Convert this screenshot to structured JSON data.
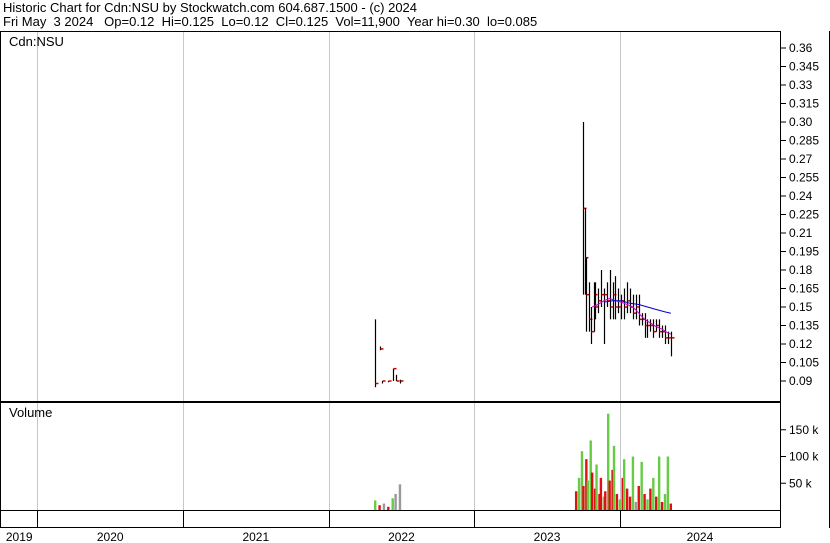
{
  "header": {
    "line1": "Historic Chart for Cdn:NSU by Stockwatch.com 604.687.1500 - (c) 2024",
    "line2": "Fri May  3 2024   Op=0.12  Hi=0.125  Lo=0.12  Cl=0.125  Vol=11,900  Year hi=0.30  lo=0.085"
  },
  "colors": {
    "price_bar": "#000000",
    "close_marker": "#cc0000",
    "moving_average_short": "#cc00cc",
    "moving_average_long": "#0000cc",
    "volume_up": "#66cc44",
    "volume_down": "#dd1111",
    "volume_flat": "#999999",
    "grid": "#c8c8c8"
  },
  "chart_data": {
    "type": "ohlc",
    "symbol_label": "Cdn:NSU",
    "volume_label": "Volume",
    "price_axis": {
      "ticks": [
        "0.36",
        "0.345",
        "0.33",
        "0.315",
        "0.30",
        "0.285",
        "0.27",
        "0.255",
        "0.24",
        "0.225",
        "0.21",
        "0.195",
        "0.18",
        "0.165",
        "0.15",
        "0.135",
        "0.12",
        "0.105",
        "0.09"
      ],
      "ylim": [
        0.075,
        0.37
      ]
    },
    "volume_axis": {
      "ticks": [
        {
          "label": "150 k",
          "value": 150000
        },
        {
          "label": "100 k",
          "value": 100000
        },
        {
          "label": "50 k",
          "value": 50000
        }
      ],
      "ylim": [
        0,
        200000
      ]
    },
    "x_axis": {
      "range": [
        2019.0,
        2024.35
      ],
      "year_labels": [
        {
          "label": "2019",
          "start": 2019.0,
          "end": 2019.25
        },
        {
          "label": "2020",
          "start": 2019.25,
          "end": 2020.25
        },
        {
          "label": "2021",
          "start": 2020.25,
          "end": 2021.25
        },
        {
          "label": "2022",
          "start": 2021.25,
          "end": 2022.25
        },
        {
          "label": "2023",
          "start": 2022.25,
          "end": 2023.25
        },
        {
          "label": "2024",
          "start": 2023.25,
          "end": 2024.35
        }
      ]
    },
    "price_bars": [
      {
        "x": 2021.57,
        "high": 0.14,
        "low": 0.085,
        "close": 0.088
      },
      {
        "x": 2021.6,
        "high": 0.118,
        "low": 0.115,
        "close": 0.116
      },
      {
        "x": 2021.62,
        "high": 0.09,
        "low": 0.088,
        "close": 0.09
      },
      {
        "x": 2021.66,
        "high": 0.09,
        "low": 0.089,
        "close": 0.09
      },
      {
        "x": 2021.69,
        "high": 0.1,
        "low": 0.09,
        "close": 0.1
      },
      {
        "x": 2021.71,
        "high": 0.095,
        "low": 0.09,
        "close": 0.09
      },
      {
        "x": 2021.74,
        "high": 0.091,
        "low": 0.088,
        "close": 0.09
      },
      {
        "x": 2023.0,
        "high": 0.3,
        "low": 0.16,
        "close": 0.23
      },
      {
        "x": 2023.01,
        "high": 0.23,
        "low": 0.16,
        "close": 0.19
      },
      {
        "x": 2023.02,
        "high": 0.19,
        "low": 0.13,
        "close": 0.16
      },
      {
        "x": 2023.04,
        "high": 0.17,
        "low": 0.13,
        "close": 0.14
      },
      {
        "x": 2023.05,
        "high": 0.15,
        "low": 0.12,
        "close": 0.13
      },
      {
        "x": 2023.07,
        "high": 0.17,
        "low": 0.13,
        "close": 0.16
      },
      {
        "x": 2023.08,
        "high": 0.17,
        "low": 0.14,
        "close": 0.15
      },
      {
        "x": 2023.1,
        "high": 0.165,
        "low": 0.145,
        "close": 0.155
      },
      {
        "x": 2023.12,
        "high": 0.18,
        "low": 0.15,
        "close": 0.16
      },
      {
        "x": 2023.14,
        "high": 0.165,
        "low": 0.12,
        "close": 0.16
      },
      {
        "x": 2023.16,
        "high": 0.17,
        "low": 0.15,
        "close": 0.155
      },
      {
        "x": 2023.18,
        "high": 0.18,
        "low": 0.14,
        "close": 0.15
      },
      {
        "x": 2023.2,
        "high": 0.17,
        "low": 0.14,
        "close": 0.16
      },
      {
        "x": 2023.22,
        "high": 0.175,
        "low": 0.14,
        "close": 0.15
      },
      {
        "x": 2023.24,
        "high": 0.165,
        "low": 0.145,
        "close": 0.15
      },
      {
        "x": 2023.26,
        "high": 0.16,
        "low": 0.14,
        "close": 0.155
      },
      {
        "x": 2023.28,
        "high": 0.165,
        "low": 0.14,
        "close": 0.15
      },
      {
        "x": 2023.3,
        "high": 0.17,
        "low": 0.145,
        "close": 0.155
      },
      {
        "x": 2023.32,
        "high": 0.165,
        "low": 0.145,
        "close": 0.15
      },
      {
        "x": 2023.34,
        "high": 0.16,
        "low": 0.14,
        "close": 0.145
      },
      {
        "x": 2023.36,
        "high": 0.16,
        "low": 0.14,
        "close": 0.15
      },
      {
        "x": 2023.38,
        "high": 0.16,
        "low": 0.135,
        "close": 0.14
      },
      {
        "x": 2023.4,
        "high": 0.145,
        "low": 0.135,
        "close": 0.14
      },
      {
        "x": 2023.42,
        "high": 0.145,
        "low": 0.125,
        "close": 0.135
      },
      {
        "x": 2023.44,
        "high": 0.14,
        "low": 0.125,
        "close": 0.135
      },
      {
        "x": 2023.46,
        "high": 0.14,
        "low": 0.13,
        "close": 0.135
      },
      {
        "x": 2023.48,
        "high": 0.14,
        "low": 0.125,
        "close": 0.13
      },
      {
        "x": 2023.5,
        "high": 0.14,
        "low": 0.13,
        "close": 0.135
      },
      {
        "x": 2023.52,
        "high": 0.14,
        "low": 0.125,
        "close": 0.13
      },
      {
        "x": 2023.54,
        "high": 0.135,
        "low": 0.125,
        "close": 0.13
      },
      {
        "x": 2023.56,
        "high": 0.135,
        "low": 0.12,
        "close": 0.125
      },
      {
        "x": 2023.58,
        "high": 0.13,
        "low": 0.12,
        "close": 0.125
      },
      {
        "x": 2023.6,
        "high": 0.13,
        "low": 0.11,
        "close": 0.125
      }
    ],
    "moving_averages": [
      {
        "name": "short",
        "points": [
          [
            2023.06,
            0.15
          ],
          [
            2023.1,
            0.152
          ],
          [
            2023.14,
            0.155
          ],
          [
            2023.18,
            0.157
          ],
          [
            2023.22,
            0.155
          ],
          [
            2023.26,
            0.154
          ],
          [
            2023.3,
            0.152
          ],
          [
            2023.34,
            0.15
          ],
          [
            2023.38,
            0.145
          ],
          [
            2023.42,
            0.14
          ],
          [
            2023.46,
            0.137
          ],
          [
            2023.5,
            0.134
          ],
          [
            2023.54,
            0.132
          ],
          [
            2023.58,
            0.129
          ],
          [
            2023.6,
            0.128
          ]
        ]
      },
      {
        "name": "long",
        "points": [
          [
            2023.14,
            0.154
          ],
          [
            2023.2,
            0.155
          ],
          [
            2023.26,
            0.155
          ],
          [
            2023.32,
            0.153
          ],
          [
            2023.38,
            0.152
          ],
          [
            2023.44,
            0.15
          ],
          [
            2023.5,
            0.148
          ],
          [
            2023.56,
            0.146
          ],
          [
            2023.6,
            0.145
          ]
        ]
      }
    ],
    "volume_bars": [
      {
        "x": 2021.57,
        "v": 18000,
        "dir": "up"
      },
      {
        "x": 2021.6,
        "v": 9000,
        "dir": "down"
      },
      {
        "x": 2021.63,
        "v": 12000,
        "dir": "flat"
      },
      {
        "x": 2021.66,
        "v": 6000,
        "dir": "down"
      },
      {
        "x": 2021.69,
        "v": 22000,
        "dir": "up"
      },
      {
        "x": 2021.71,
        "v": 30000,
        "dir": "flat"
      },
      {
        "x": 2021.74,
        "v": 48000,
        "dir": "flat"
      },
      {
        "x": 2022.95,
        "v": 35000,
        "dir": "down"
      },
      {
        "x": 2022.97,
        "v": 60000,
        "dir": "up"
      },
      {
        "x": 2022.99,
        "v": 110000,
        "dir": "up"
      },
      {
        "x": 2023.0,
        "v": 45000,
        "dir": "down"
      },
      {
        "x": 2023.02,
        "v": 95000,
        "dir": "down"
      },
      {
        "x": 2023.03,
        "v": 55000,
        "dir": "up"
      },
      {
        "x": 2023.05,
        "v": 130000,
        "dir": "up"
      },
      {
        "x": 2023.06,
        "v": 70000,
        "dir": "down"
      },
      {
        "x": 2023.08,
        "v": 40000,
        "dir": "down"
      },
      {
        "x": 2023.09,
        "v": 85000,
        "dir": "up"
      },
      {
        "x": 2023.11,
        "v": 30000,
        "dir": "down"
      },
      {
        "x": 2023.12,
        "v": 60000,
        "dir": "down"
      },
      {
        "x": 2023.14,
        "v": 25000,
        "dir": "up"
      },
      {
        "x": 2023.15,
        "v": 35000,
        "dir": "down"
      },
      {
        "x": 2023.17,
        "v": 180000,
        "dir": "up"
      },
      {
        "x": 2023.18,
        "v": 55000,
        "dir": "down"
      },
      {
        "x": 2023.2,
        "v": 75000,
        "dir": "down"
      },
      {
        "x": 2023.21,
        "v": 120000,
        "dir": "up"
      },
      {
        "x": 2023.23,
        "v": 30000,
        "dir": "down"
      },
      {
        "x": 2023.25,
        "v": 20000,
        "dir": "up"
      },
      {
        "x": 2023.27,
        "v": 60000,
        "dir": "down"
      },
      {
        "x": 2023.28,
        "v": 95000,
        "dir": "up"
      },
      {
        "x": 2023.3,
        "v": 40000,
        "dir": "down"
      },
      {
        "x": 2023.32,
        "v": 25000,
        "dir": "down"
      },
      {
        "x": 2023.34,
        "v": 100000,
        "dir": "up"
      },
      {
        "x": 2023.36,
        "v": 15000,
        "dir": "flat"
      },
      {
        "x": 2023.38,
        "v": 45000,
        "dir": "down"
      },
      {
        "x": 2023.4,
        "v": 90000,
        "dir": "up"
      },
      {
        "x": 2023.42,
        "v": 30000,
        "dir": "down"
      },
      {
        "x": 2023.44,
        "v": 20000,
        "dir": "up"
      },
      {
        "x": 2023.46,
        "v": 40000,
        "dir": "down"
      },
      {
        "x": 2023.48,
        "v": 60000,
        "dir": "up"
      },
      {
        "x": 2023.5,
        "v": 25000,
        "dir": "down"
      },
      {
        "x": 2023.52,
        "v": 100000,
        "dir": "up"
      },
      {
        "x": 2023.54,
        "v": 15000,
        "dir": "down"
      },
      {
        "x": 2023.56,
        "v": 30000,
        "dir": "up"
      },
      {
        "x": 2023.58,
        "v": 100000,
        "dir": "up"
      },
      {
        "x": 2023.6,
        "v": 12000,
        "dir": "down"
      }
    ]
  }
}
